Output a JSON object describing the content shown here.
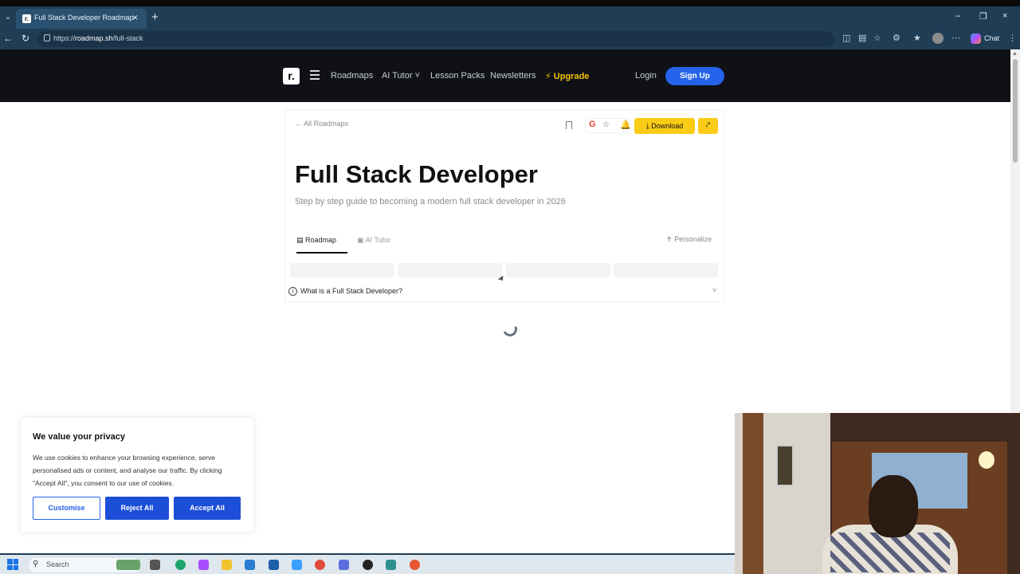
{
  "browser": {
    "tab_title": "Full Stack Developer Roadmap",
    "tab_favicon": "r.",
    "url_prefix": "https://",
    "url_host": "roadmap.sh",
    "url_path": "/full-stack",
    "chat_label": "Chat"
  },
  "header": {
    "logo_text": "r.",
    "nav": [
      "Roadmaps",
      "AI Tutor",
      "Lesson Packs",
      "Newsletters"
    ],
    "upgrade_label": "Upgrade",
    "login_label": "Login",
    "signup_label": "Sign Up"
  },
  "roadmap": {
    "back_label": "All Roadmaps",
    "download_label": "Download",
    "title": "Full Stack Developer",
    "subtitle": "Step by step guide to becoming a modern full stack developer in 2026",
    "tabs": [
      "Roadmap",
      "AI Tutor"
    ],
    "personalize_label": "Personalize",
    "faq_question": "What is a Full Stack Developer?"
  },
  "cookie": {
    "title": "We value your privacy",
    "text": "We use cookies to enhance your browsing experience, serve personalised ads or content, and analyse our traffic. By clicking \"Accept All\", you consent to our use of cookies.",
    "customise_label": "Customise",
    "reject_label": "Reject All",
    "accept_label": "Accept All"
  },
  "taskbar": {
    "search_placeholder": "Search"
  },
  "colors": {
    "accent_blue": "#2563eb",
    "download_yellow": "#facc15",
    "upgrade_yellow": "#f5c400",
    "header_bg": "#0f1117"
  }
}
